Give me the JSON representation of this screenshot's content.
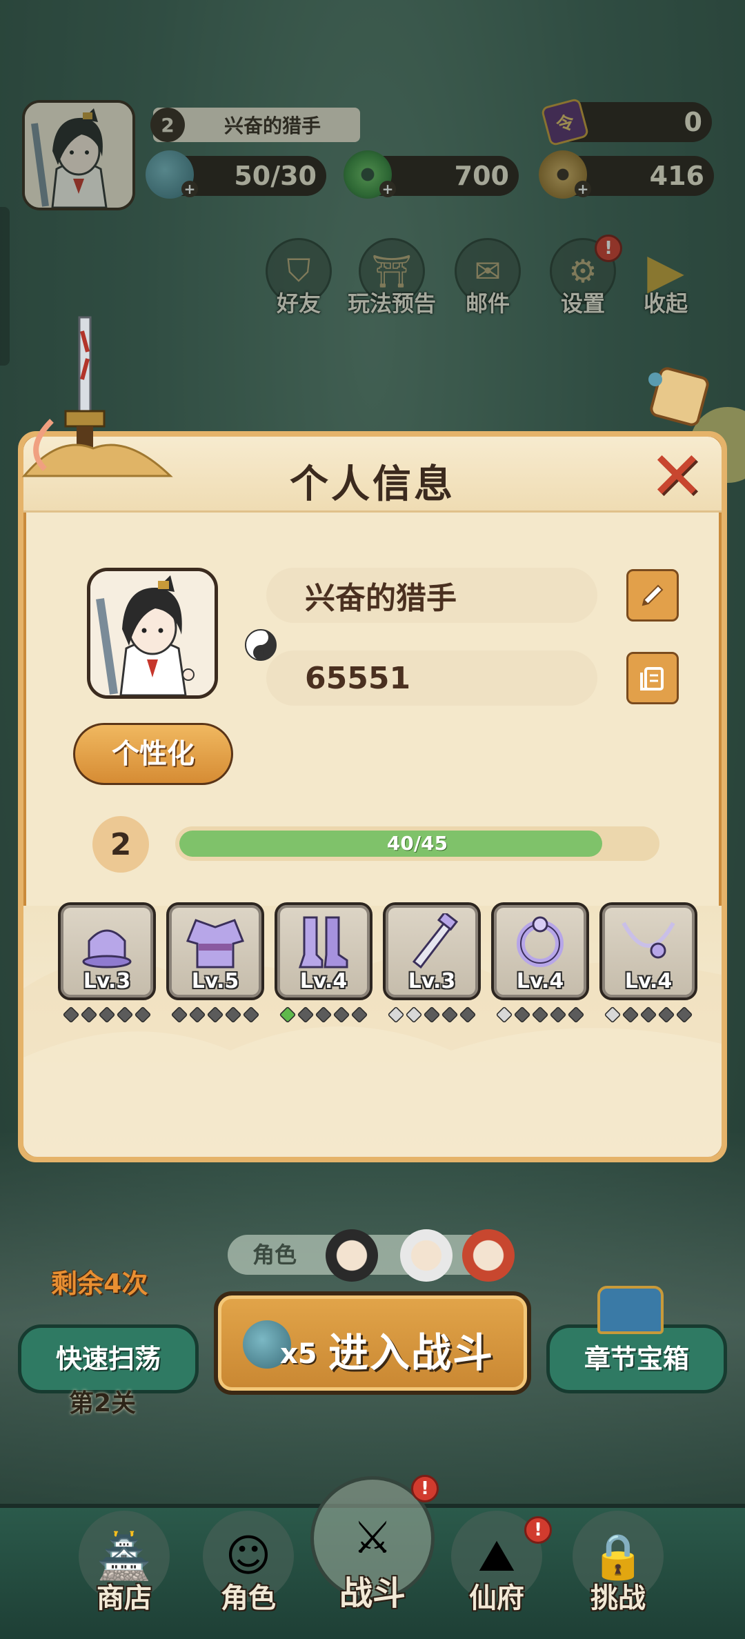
{
  "player": {
    "level": "2",
    "name": "兴奋的猎手",
    "id": "65551"
  },
  "resources": {
    "ticket": {
      "icon": "token-icon",
      "value": "0"
    },
    "stamina": {
      "icon": "gourd-icon",
      "value": "50/30"
    },
    "jade": {
      "icon": "jade-icon",
      "value": "700"
    },
    "coins": {
      "icon": "coin-icon",
      "value": "416"
    }
  },
  "top_menu": {
    "friends": "好友",
    "preview": "玩法预告",
    "mail": "邮件",
    "settings": "设置",
    "collapse": "收起",
    "settings_badge": "!"
  },
  "modal": {
    "title": "个人信息",
    "close": "✕",
    "personalize_label": "个性化",
    "xp_text": "40/45",
    "xp_fraction": 0.889
  },
  "equipment": [
    {
      "name": "hat",
      "level": "Lv.3",
      "stars": [
        "d",
        "d",
        "d",
        "d",
        "d"
      ]
    },
    {
      "name": "robe",
      "level": "Lv.5",
      "stars": [
        "d",
        "d",
        "d",
        "d",
        "d"
      ]
    },
    {
      "name": "boots",
      "level": "Lv.4",
      "stars": [
        "g",
        "d",
        "d",
        "d",
        "d"
      ]
    },
    {
      "name": "sword",
      "level": "Lv.3",
      "stars": [
        "w",
        "w",
        "d",
        "d",
        "d"
      ]
    },
    {
      "name": "ring",
      "level": "Lv.4",
      "stars": [
        "w",
        "d",
        "d",
        "d",
        "d"
      ]
    },
    {
      "name": "necklace",
      "level": "Lv.4",
      "stars": [
        "w",
        "d",
        "d",
        "d",
        "d"
      ]
    }
  ],
  "bottom": {
    "team_label": "角色",
    "remaining": "剩余4次",
    "sweep": "快速扫荡",
    "stage": "第2关",
    "battle_cost": "x5",
    "battle_label": "进入战斗",
    "chest": "章节宝箱"
  },
  "nav": {
    "shop": "商店",
    "role": "角色",
    "battle": "战斗",
    "realm": "仙府",
    "challenge": "挑战",
    "badge": "!"
  },
  "colors": {
    "modal_bg": "#f4e8cb",
    "modal_border": "#e5b36a",
    "xp_fill": "#7fc26a",
    "accent_orange": "#e2a04a",
    "alert_red": "#d13b2e"
  }
}
